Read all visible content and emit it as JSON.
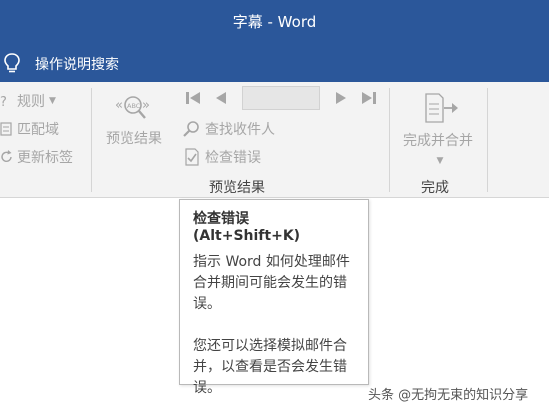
{
  "window": {
    "title": "字幕 - Word"
  },
  "tell_me": {
    "label": "操作说明搜索"
  },
  "ribbon": {
    "write_insert": {
      "rules": "规则",
      "match_fields": "匹配域",
      "update_labels": "更新标签"
    },
    "preview": {
      "preview_results": "预览结果",
      "record_value": "",
      "find_recipient": "查找收件人",
      "check_errors": "检查错误",
      "group_label": "预览结果"
    },
    "finish": {
      "finish_merge": "完成并合并",
      "group_label": "完成"
    }
  },
  "tooltip": {
    "title": "检查错误 (Alt+Shift+K)",
    "paragraph1": "指示 Word 如何处理邮件合并期间可能会发生的错误。",
    "paragraph2": "您还可以选择模拟邮件合并，以查看是否会发生错误。"
  },
  "watermark": {
    "text": "头条 @无拘无束的知识分享"
  },
  "colors": {
    "title_bar": "#2b579a",
    "ribbon": "#f3f3f3",
    "disabled_text": "#a6a6a6"
  }
}
